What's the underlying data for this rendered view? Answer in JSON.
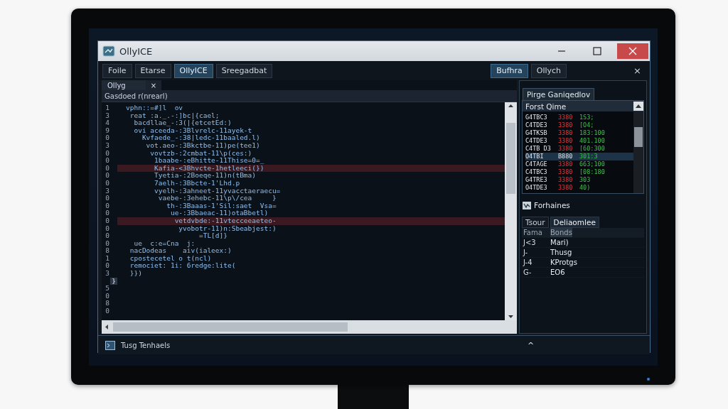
{
  "window": {
    "title": "OllyICE"
  },
  "tabs": [
    {
      "label": "Foile",
      "selected": false
    },
    {
      "label": "Etarse",
      "selected": false
    },
    {
      "label": "OllyICE",
      "selected": true
    },
    {
      "label": "Sreegadbat",
      "selected": false
    }
  ],
  "right_tabs": [
    {
      "label": "Bufhra",
      "selected": true
    },
    {
      "label": "Ollych",
      "selected": false
    }
  ],
  "right_close": "×",
  "editor": {
    "tab": {
      "label": "Ollyg",
      "close": "×"
    },
    "subtitle": "Gasdoed r(nrearl)",
    "lines": [
      {
        "number": "1",
        "text": "vphn::=#]l  ov",
        "highlighted": false
      },
      {
        "number": "3",
        "text": " reat :a._.-:]bc|{cael;",
        "highlighted": false
      },
      {
        "number": "4",
        "text": "  bacdllae_-:3(|{etcetEd:)",
        "highlighted": false
      },
      {
        "number": "9",
        "text": "  ovi aceeda-:3Blvrelc-11ayek-t",
        "highlighted": false
      },
      {
        "number": "0",
        "text": "    Kvfaede_-:38|ledc-11baaled.l)",
        "highlighted": false
      },
      {
        "number": "3",
        "text": "     vot.aeo-:3Bkctbe-11)pe(tee1)",
        "highlighted": false
      },
      {
        "number": "0",
        "text": "      vovtzb-:2cmbat-11\\p(ces:)",
        "highlighted": false
      },
      {
        "number": "0",
        "text": "       1baabe-:eBhitte-11Thise=0=_",
        "highlighted": false
      },
      {
        "number": "0",
        "text": "       Kafia-<3Bhvcte-1hetleeci(})",
        "highlighted": true
      },
      {
        "number": "0",
        "text": "       Tyetia-:2Boeqe-11)n(tBma)",
        "highlighted": false
      },
      {
        "number": "0",
        "text": "       7aelh-:3Bbcte-1'Lhd.p",
        "highlighted": false
      },
      {
        "number": "3",
        "text": "       vyelh-:3ahneet-11yvacctaeraecu=",
        "highlighted": false
      },
      {
        "number": "0",
        "text": "        vaebe-:3ehebc-11\\p\\/cea     }",
        "highlighted": false
      },
      {
        "number": "0",
        "text": "          th-:3Baaas-1'Sil:saet  Vsa=",
        "highlighted": false
      },
      {
        "number": "0",
        "text": "           ue-:3Bbaeac-11)otaBbetl)",
        "highlighted": false
      },
      {
        "number": "0",
        "text": "            vetdvbde:-11vtecceeaeteo-",
        "highlighted": true
      },
      {
        "number": "0",
        "text": "             yvobotr-11)n:Sbeabjest:)",
        "highlighted": false
      },
      {
        "number": "0",
        "text": "                  =TL[d]}",
        "highlighted": false
      },
      {
        "number": "0",
        "text": "  ue  c:e=Cna  j:",
        "highlighted": false
      },
      {
        "number": "8",
        "text": " nacDodeas    aiv(ialeex:)",
        "highlighted": false
      },
      {
        "number": "1",
        "text": " cpostecetel o t(ncl)",
        "highlighted": false
      },
      {
        "number": "0",
        "text": " remociet: 1i: 6redge:lite(",
        "highlighted": false
      },
      {
        "number": "3",
        "text": " }})",
        "highlighted": false
      }
    ],
    "extra_numbers": [
      "}",
      "5",
      "0",
      "8",
      "0"
    ]
  },
  "watch_panel": {
    "title": "Pirge Ganiqedlov",
    "header": "Forst Qime",
    "rows": [
      {
        "cells": [
          "G4TBC3",
          "3380",
          "1S3;"
        ],
        "selected": false
      },
      {
        "cells": [
          "C4TDE3",
          "3380",
          "[O4;"
        ],
        "selected": false
      },
      {
        "cells": [
          "G4TKSB",
          "3380",
          "183:100"
        ],
        "selected": false
      },
      {
        "cells": [
          "C4TDE3",
          "3380",
          "401.100"
        ],
        "selected": false
      },
      {
        "cells": [
          "C4TB D3",
          "3380",
          "[60:300"
        ],
        "selected": false
      },
      {
        "cells": [
          "O4TBI",
          "B880",
          "301:3"
        ],
        "selected": true
      },
      {
        "cells": [
          "C4TAGE",
          "3380",
          "663;100"
        ],
        "selected": false
      },
      {
        "cells": [
          "C4TBC3",
          "3380",
          "[08:180"
        ],
        "selected": false
      },
      {
        "cells": [
          "G4TRE3",
          "3380",
          "303"
        ],
        "selected": false
      },
      {
        "cells": [
          "O4TDE3",
          "3380",
          "40)"
        ],
        "selected": false
      }
    ]
  },
  "bottom_panel": {
    "title": "Forhaines",
    "tabs": [
      {
        "label": "Tsour",
        "selected": false
      },
      {
        "label": "Deliaomlee",
        "selected": true
      }
    ],
    "columns": [
      "Fama",
      "Bonds"
    ],
    "rows": [
      [
        "J<3",
        "Mari)"
      ],
      [
        "J-",
        "Thusg"
      ],
      [
        "J-4",
        "KProtgs"
      ],
      [
        "G-",
        "EO6"
      ]
    ]
  },
  "status_bar": {
    "text": "Tusg Tenhaels",
    "button": "^"
  }
}
